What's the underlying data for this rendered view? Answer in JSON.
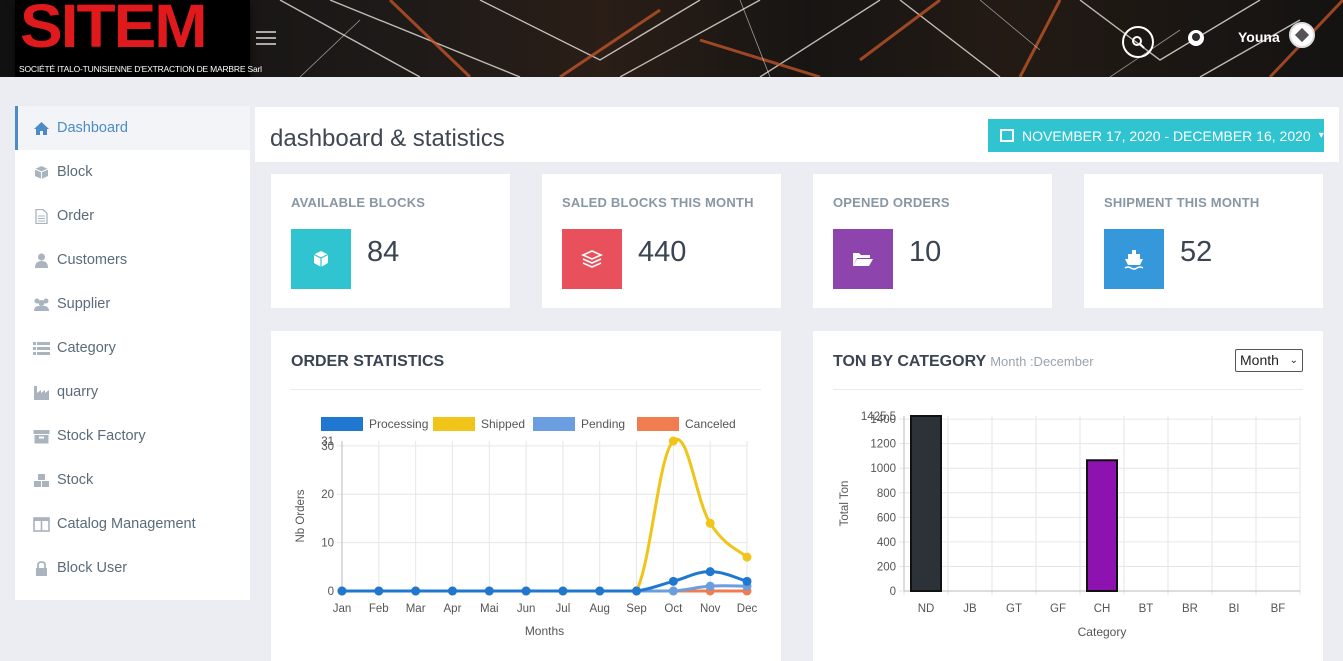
{
  "header": {
    "logo": "SITEM",
    "logo_subtitle": "SOCIÉTÉ ITALO-TUNISIENNE D'EXTRACTION DE MARBRE Sarl",
    "username": "Youna"
  },
  "sidebar": {
    "items": [
      {
        "label": "Dashboard",
        "icon": "home-icon"
      },
      {
        "label": "Block",
        "icon": "cube-icon"
      },
      {
        "label": "Order",
        "icon": "file-icon"
      },
      {
        "label": "Customers",
        "icon": "user-icon"
      },
      {
        "label": "Supplier",
        "icon": "users-icon"
      },
      {
        "label": "Category",
        "icon": "list-icon"
      },
      {
        "label": "quarry",
        "icon": "industry-icon"
      },
      {
        "label": "Stock Factory",
        "icon": "archive-icon"
      },
      {
        "label": "Stock",
        "icon": "cubes-icon"
      },
      {
        "label": "Catalog Management",
        "icon": "columns-icon"
      },
      {
        "label": "Block User",
        "icon": "lock-icon"
      }
    ]
  },
  "page": {
    "title": "dashboard & statistics",
    "date_range": "NOVEMBER 17, 2020 - DECEMBER 16, 2020"
  },
  "cards": [
    {
      "label": "AVAILABLE BLOCKS",
      "value": "84",
      "color": "#2fc4d0",
      "icon": "cube-icon"
    },
    {
      "label": "SALED BLOCKS THIS MONTH",
      "value": "440",
      "color": "#e8505b",
      "icon": "layers-icon"
    },
    {
      "label": "OPENED ORDERS",
      "value": "10",
      "color": "#8e44ad",
      "icon": "folder-open-icon"
    },
    {
      "label": "SHIPMENT THIS MONTH",
      "value": "52",
      "color": "#3498db",
      "icon": "ship-icon"
    }
  ],
  "order_panel": {
    "title": "ORDER STATISTICS"
  },
  "ton_panel": {
    "title": "TON BY CATEGORY",
    "subtitle": "Month :December",
    "select_value": "Month"
  },
  "chart_data": [
    {
      "type": "line",
      "x": [
        "Jan",
        "Feb",
        "Mar",
        "Apr",
        "Mai",
        "Jun",
        "Jul",
        "Aug",
        "Sep",
        "Oct",
        "Nov",
        "Dec"
      ],
      "series": [
        {
          "name": "Processing",
          "color": "#1f77d0",
          "values": [
            0,
            0,
            0,
            0,
            0,
            0,
            0,
            0,
            0,
            2,
            4,
            2
          ]
        },
        {
          "name": "Shipped",
          "color": "#f0c419",
          "values": [
            0,
            0,
            0,
            0,
            0,
            0,
            0,
            0,
            0,
            31,
            14,
            7
          ]
        },
        {
          "name": "Pending",
          "color": "#6a9ee0",
          "values": [
            0,
            0,
            0,
            0,
            0,
            0,
            0,
            0,
            0,
            0,
            1,
            1
          ]
        },
        {
          "name": "Canceled",
          "color": "#f07c50",
          "values": [
            0,
            0,
            0,
            0,
            0,
            0,
            0,
            0,
            0,
            0,
            0,
            0
          ]
        }
      ],
      "xlabel": "Months",
      "ylabel": "Nb Orders",
      "ylim": [
        0,
        31
      ],
      "yticks": [
        0,
        10,
        20,
        30
      ],
      "max_label": "31",
      "grid": true,
      "legend": "top"
    },
    {
      "type": "bar",
      "categories": [
        "ND",
        "JB",
        "GT",
        "GF",
        "CH",
        "BT",
        "BR",
        "BI",
        "BF"
      ],
      "values": [
        1425.5,
        0,
        0,
        0,
        1065,
        0,
        0,
        0,
        0
      ],
      "colors": [
        "#2d3238",
        "#2d3238",
        "#2d3238",
        "#2d3238",
        "#8e12b0",
        "#2d3238",
        "#2d3238",
        "#2d3238",
        "#2d3238"
      ],
      "xlabel": "Category",
      "ylabel": "Total Ton",
      "ylim": [
        0,
        1425.5
      ],
      "yticks": [
        0,
        200,
        400,
        600,
        800,
        1000,
        1200,
        1400
      ],
      "max_label": "1425.5",
      "grid": true
    }
  ]
}
